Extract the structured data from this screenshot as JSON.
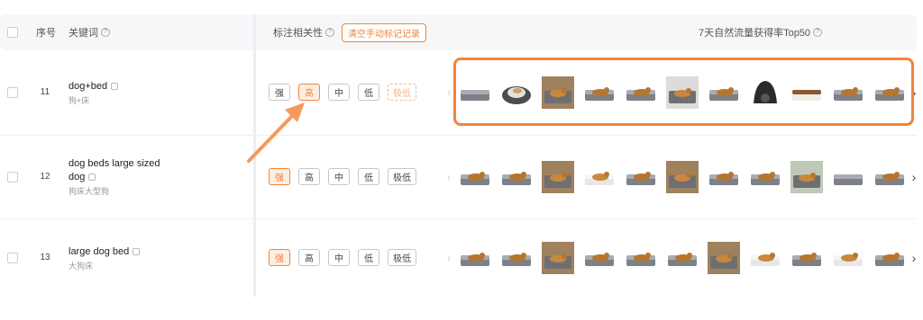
{
  "header": {
    "seq_label": "序号",
    "keyword_label": "关键词",
    "relevance_label": "标注相关性",
    "clear_button": "清空手动标记记录",
    "top_label": "7天自然流量获得率Top50",
    "help_icon": "?"
  },
  "relevance_options": [
    "强",
    "高",
    "中",
    "低",
    "极低"
  ],
  "rows": [
    {
      "seq": "11",
      "keyword_en": "dog+bed",
      "keyword_zh": "狗+床",
      "selected": "高",
      "pending": "极低",
      "thumbs": [
        "bed-gray",
        "donut-dark",
        "photo-tan",
        "bed-dog",
        "bed-dog",
        "photo-room",
        "bed-dog",
        "cave-black",
        "bed-brown",
        "bed-dog",
        "bed-dog"
      ]
    },
    {
      "seq": "12",
      "keyword_en": "dog beds large sized",
      "keyword_en_line2": "dog",
      "keyword_zh": "狗床大型狗",
      "selected": "强",
      "pending": "",
      "thumbs": [
        "bed-dog",
        "bed-dog",
        "photo-tan",
        "bed-white",
        "bed-dog",
        "photo-tan",
        "bed-dog",
        "bed-dog",
        "photo-green",
        "bed-gray",
        "bed-dog"
      ]
    },
    {
      "seq": "13",
      "keyword_en": "large dog bed",
      "keyword_zh": "大狗床",
      "selected": "强",
      "pending": "",
      "thumbs": [
        "bed-dog",
        "bed-dog",
        "photo-tan",
        "bed-dog",
        "bed-dog",
        "bed-dog",
        "photo-tan",
        "bed-white",
        "bed-dog",
        "bed-white",
        "bed-dog"
      ]
    }
  ],
  "colors": {
    "accent": "#f0843c",
    "header_bg": "#f6f7f9"
  },
  "icons": {
    "prev": "‹",
    "next": "›"
  }
}
